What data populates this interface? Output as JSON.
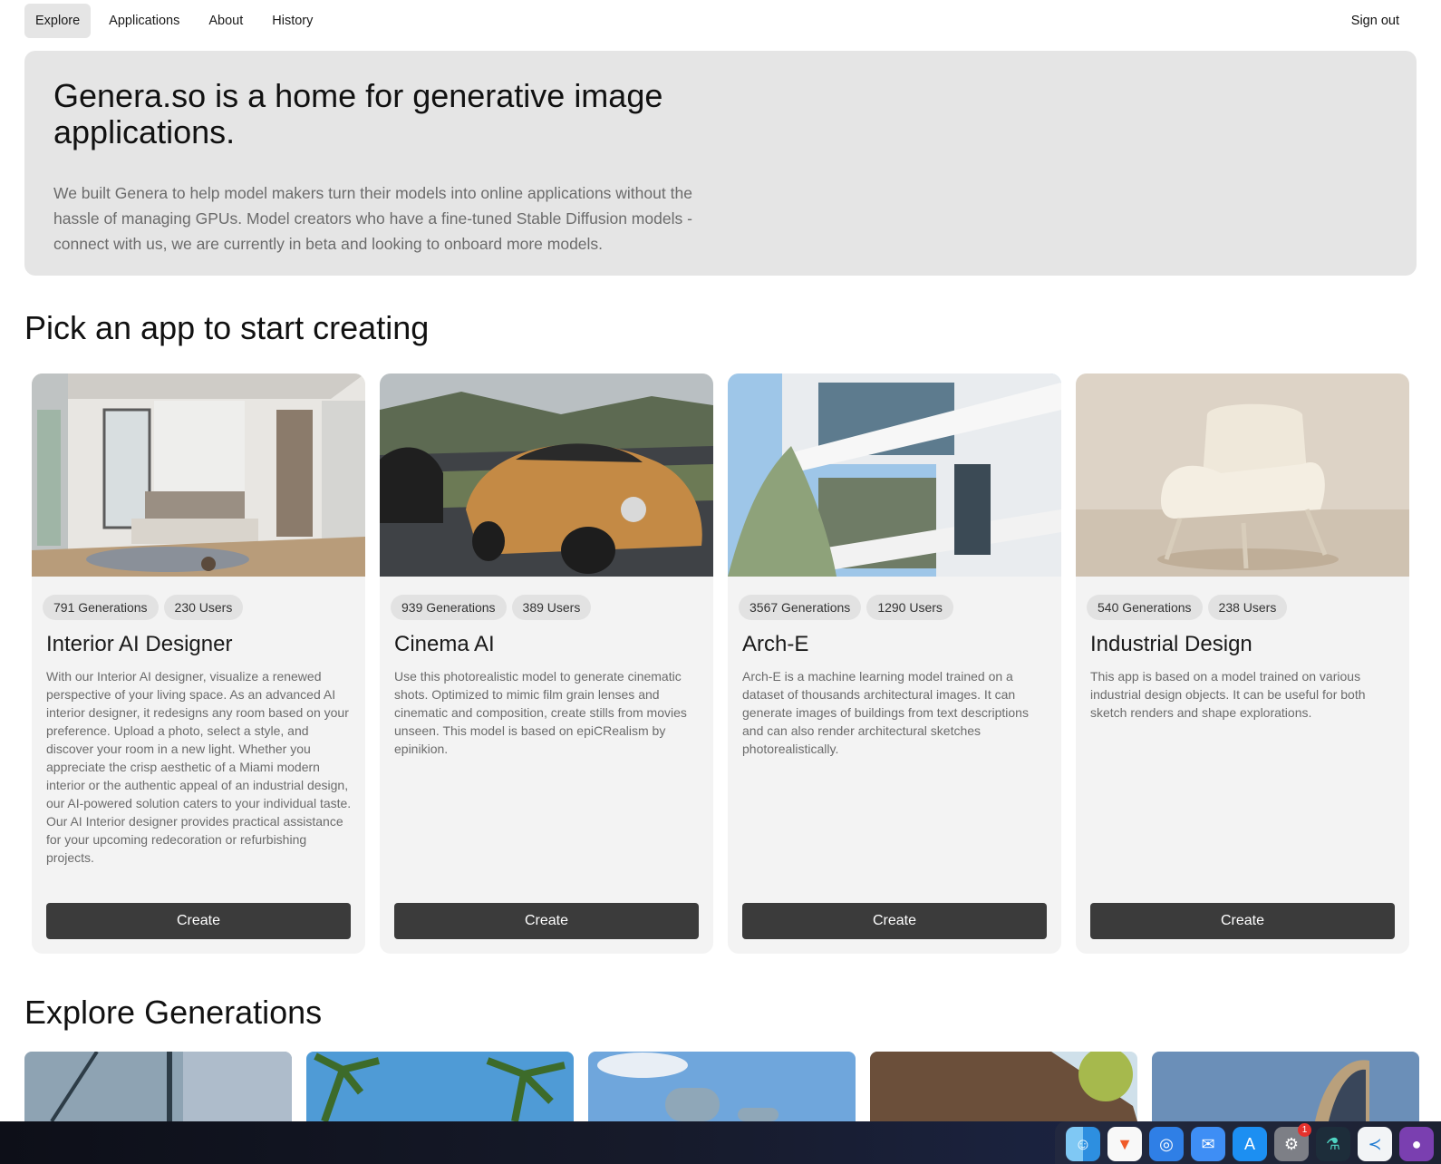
{
  "nav": {
    "tabs": [
      {
        "label": "Explore",
        "active": true
      },
      {
        "label": "Applications"
      },
      {
        "label": "About"
      },
      {
        "label": "History"
      }
    ],
    "sign_out": "Sign out"
  },
  "hero": {
    "title": "Genera.so is a home for generative image applications.",
    "description": "We built Genera to help model makers turn their models into online applications without the hassle of managing GPUs. Model creators who have a fine-tuned Stable Diffusion models - connect with us, we are currently in beta and looking to onboard more models."
  },
  "apps_section": {
    "title": "Pick an app to start creating",
    "apps": [
      {
        "name": "Interior AI Designer",
        "generations": "791 Generations",
        "users": "230 Users",
        "description": "With our Interior AI designer, visualize a renewed perspective of your living space. As an advanced AI interior designer, it redesigns any room based on your preference. Upload a photo, select a style, and discover your room in a new light. Whether you appreciate the crisp aesthetic of a Miami modern interior or the authentic appeal of an industrial design, our AI-powered solution caters to your individual taste. Our AI Interior designer provides practical assistance for your upcoming redecoration or refurbishing projects.",
        "button": "Create"
      },
      {
        "name": "Cinema AI",
        "generations": "939 Generations",
        "users": "389 Users",
        "description": "Use this photorealistic model to generate cinematic shots. Optimized to mimic film grain lenses and cinematic and composition, create stills from movies unseen. This model is based on epiCRealism by epinikion.",
        "button": "Create"
      },
      {
        "name": "Arch-E",
        "generations": "3567 Generations",
        "users": "1290 Users",
        "description": "Arch-E is a machine learning model trained on a dataset of thousands architectural images. It can generate images of buildings from text descriptions and can also render architectural sketches photorealistically.",
        "button": "Create"
      },
      {
        "name": "Industrial Design",
        "generations": "540 Generations",
        "users": "238 Users",
        "description": "This app is based on a model trained on various industrial design objects. It can be useful for both sketch renders and shape explorations.",
        "button": "Create"
      }
    ]
  },
  "generations_section": {
    "title": "Explore Generations"
  },
  "dock": {
    "apps": [
      "finder-icon",
      "brave-icon",
      "safari-icon",
      "mail-icon",
      "app-store-icon",
      "system-settings-icon",
      "lab-flask-icon",
      "vscode-icon",
      "github-icon"
    ],
    "settings_badge": "1"
  }
}
